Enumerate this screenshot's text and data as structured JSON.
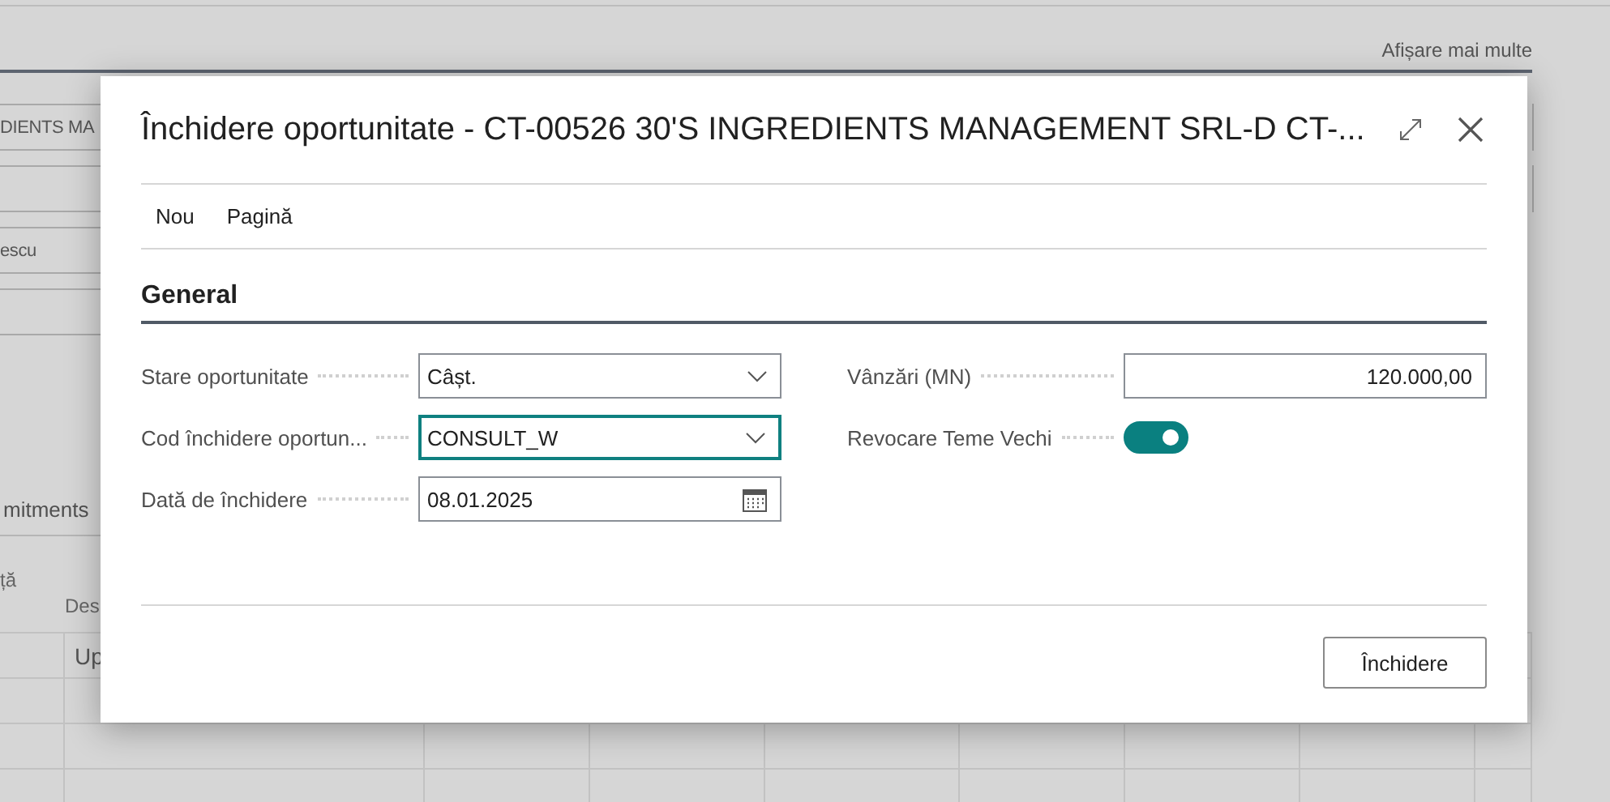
{
  "background_page": {
    "show_more_link": "Afișare mai multe",
    "field_values": [
      "DIENTS MA",
      "escu"
    ],
    "tab_label": "mitments",
    "column_headers": [
      "ță",
      "Des"
    ],
    "cell": "Up"
  },
  "dialog": {
    "title": "Închidere oportunitate - CT-00526 30'S INGREDIENTS MANAGEMENT SRL-D CT-...",
    "menu": [
      {
        "label": "Nou"
      },
      {
        "label": "Pagină"
      }
    ],
    "section": "General",
    "columns": [
      [
        {
          "kind": "dropdown",
          "label": "Stare oportunitate",
          "value": "Câșt.",
          "focused": false
        },
        {
          "kind": "dropdown",
          "label": "Cod închidere oportun...",
          "value": "CONSULT_W",
          "focused": true
        },
        {
          "kind": "date",
          "label": "Dată de închidere",
          "value": "08.01.2025",
          "focused": false
        }
      ],
      [
        {
          "kind": "amount",
          "label": "Vânzări (MN)",
          "value": "120.000,00",
          "focused": false
        },
        {
          "kind": "toggle",
          "label": "Revocare Teme Vechi",
          "on": true
        }
      ]
    ],
    "button": "Închidere"
  }
}
